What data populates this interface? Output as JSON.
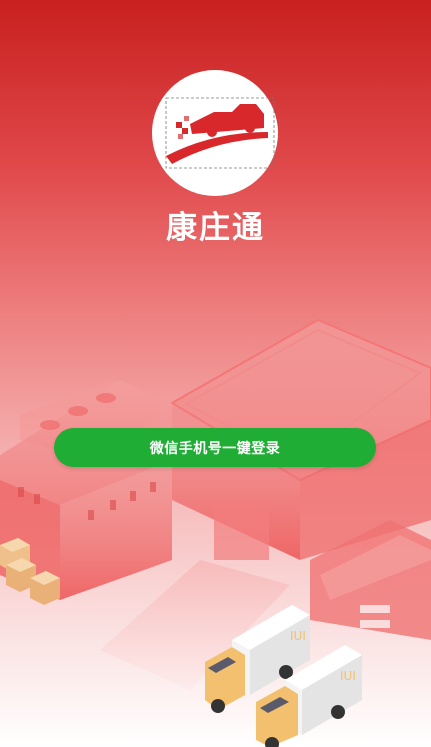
{
  "app": {
    "name": "康庄通",
    "logo_icon": "truck-logo-icon",
    "brand_color": "#d9282b"
  },
  "login": {
    "wechat_phone_button": "微信手机号一键登录",
    "button_color": "#20ad36"
  },
  "illustration": {
    "icon": "warehouse-delivery-illustration"
  }
}
